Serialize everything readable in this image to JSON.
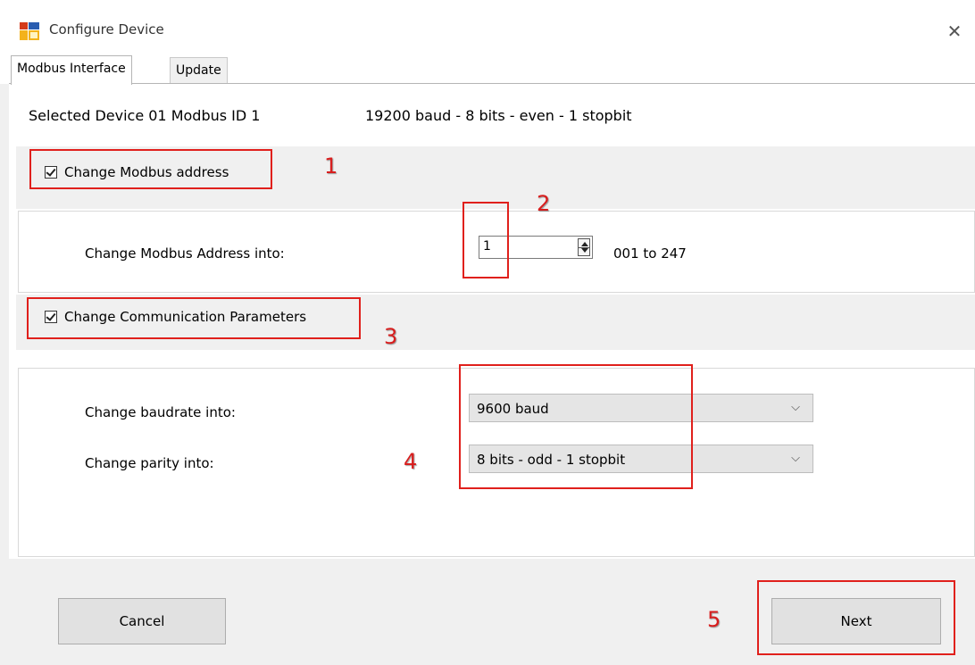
{
  "window": {
    "title": "Configure Device",
    "close_glyph": "✕"
  },
  "tabs": [
    {
      "label": "Modbus Interface",
      "active": true
    },
    {
      "label": "Update",
      "active": false
    }
  ],
  "device_info": {
    "selected": "Selected Device 01 Modbus ID 1",
    "comm": "19200 baud - 8 bits - even - 1 stopbit"
  },
  "address_section": {
    "checkbox_label": "Change Modbus address",
    "checked": true,
    "field_label": "Change Modbus Address into:",
    "value": "1",
    "range": "001 to 247"
  },
  "comm_section": {
    "checkbox_label": "Change Communication Parameters",
    "checked": true,
    "baud_label": "Change baudrate into:",
    "baud_value": "9600 baud",
    "parity_label": "Change parity into:",
    "parity_value": "8 bits - odd - 1 stopbit"
  },
  "buttons": {
    "cancel": "Cancel",
    "next": "Next"
  },
  "annotations": {
    "n1": "1",
    "n2": "2",
    "n3": "3",
    "n4": "4",
    "n5": "5",
    "color": "#e0201c"
  },
  "icons": {
    "app": "app-window-icon",
    "chevron": "chevron-down-icon"
  }
}
